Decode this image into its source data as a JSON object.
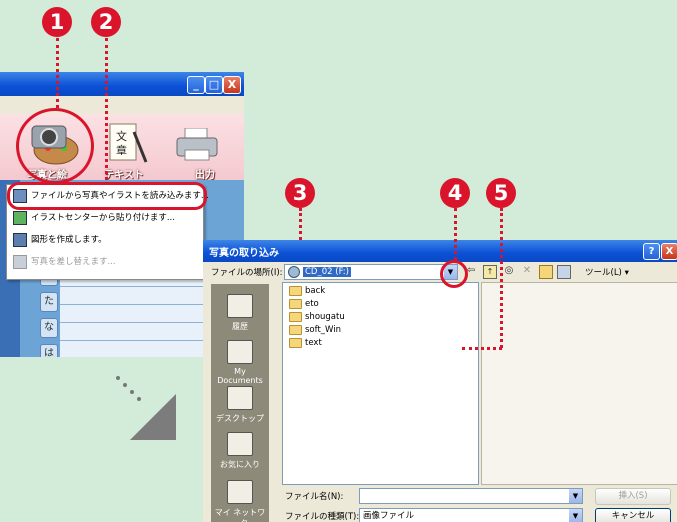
{
  "badges": [
    "1",
    "2",
    "3",
    "4",
    "5"
  ],
  "app": {
    "toolbar": {
      "photo_label": "写真と絵",
      "text_label": "テキスト",
      "output_label": "出力"
    },
    "window_controls": {
      "minimize": "_",
      "maximize": "□",
      "close": "X"
    },
    "kana_tabs": [
      "て",
      "た",
      "な",
      "は"
    ]
  },
  "menu": {
    "items": [
      {
        "label": "ファイルから写真やイラストを読み込みます...",
        "disabled": false
      },
      {
        "label": "イラストセンターから貼り付けます...",
        "disabled": false
      },
      {
        "label": "図形を作成します。",
        "disabled": false
      },
      {
        "label": "写真を差し替えます...",
        "disabled": true
      }
    ]
  },
  "dialog": {
    "title": "写真の取り込み",
    "help_button": "?",
    "close_button": "X",
    "location_label": "ファイルの場所(I):",
    "location_value": "CD_02 (F:)",
    "tools_label": "ツール(L) ▾",
    "places": [
      "履歴",
      "My Documents",
      "デスクトップ",
      "お気に入り",
      "マイ ネットワーク"
    ],
    "files": [
      "back",
      "eto",
      "shougatu",
      "soft_Win",
      "text"
    ],
    "filename_label": "ファイル名(N):",
    "filename_value": "",
    "filetype_label": "ファイルの種類(T):",
    "filetype_value": "画像ファイル",
    "insert_button": "挿入(S)",
    "cancel_button": "キャンセル"
  },
  "colors": {
    "callout": "#d9142b",
    "titlebar": "#0b50d6",
    "background": "#d3ebd9"
  },
  "icons": [
    "camera-palette-icon",
    "text-scroll-icon",
    "printer-icon",
    "folder-icon",
    "back-arrow-icon",
    "up-folder-icon",
    "search-web-icon",
    "delete-icon",
    "new-folder-icon",
    "view-menu-icon"
  ]
}
